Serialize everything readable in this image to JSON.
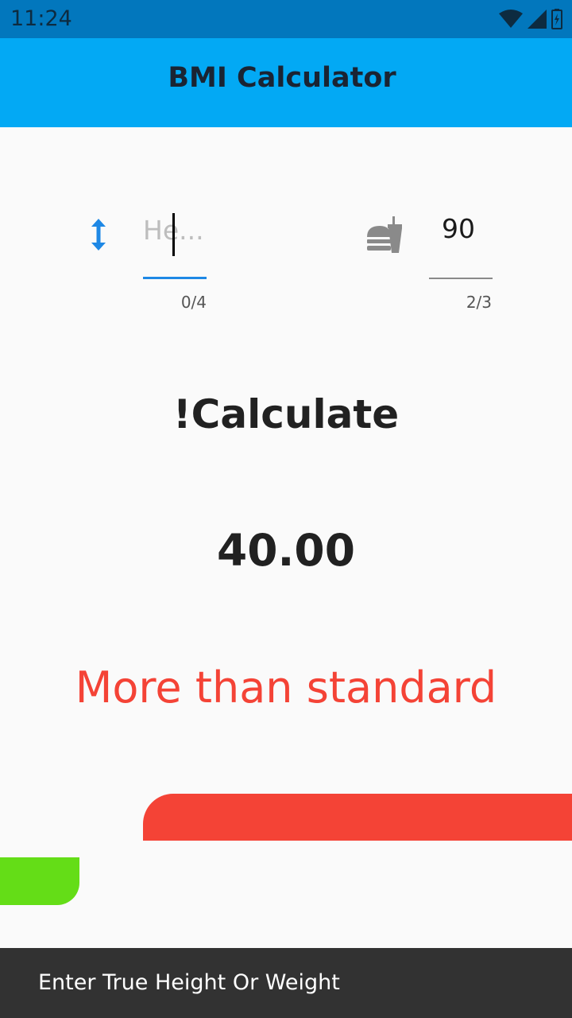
{
  "status_bar": {
    "time": "11:24",
    "icons": [
      "wifi-icon",
      "signal-icon",
      "battery-icon"
    ]
  },
  "app_bar": {
    "title": "BMI Calculator"
  },
  "height_field": {
    "icon": "height-arrows-icon",
    "placeholder": "He...",
    "value": "",
    "counter": "0/4"
  },
  "weight_field": {
    "icon": "fastfood-icon",
    "value": "90",
    "counter": "2/3"
  },
  "calculate_button": {
    "label": "!Calculate"
  },
  "result": {
    "bmi": "40.00",
    "status": "More than standard"
  },
  "snackbar": {
    "message": "Enter True Height Or Weight"
  },
  "colors": {
    "status_bar": "#0277bd",
    "app_bar": "#03a9f4",
    "accent_blue": "#1e88e5",
    "status_red": "#f44336",
    "green": "#64dd17",
    "snackbar": "#323232"
  }
}
